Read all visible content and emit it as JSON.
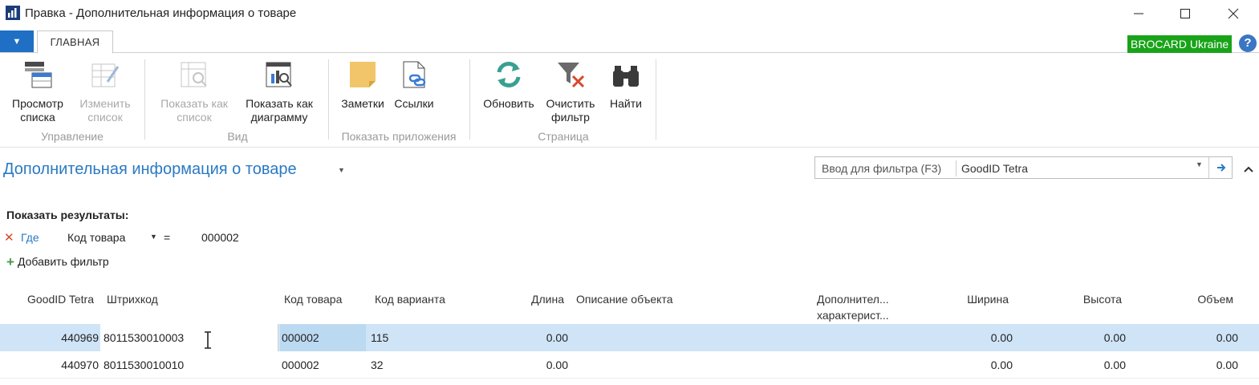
{
  "window": {
    "title": "Правка - Дополнительная информация о товаре"
  },
  "ribbon": {
    "home_tab": "ГЛАВНАЯ",
    "company": "BROCARD Ukraine",
    "help": "?",
    "groups": {
      "manage": "Управление",
      "view": "Вид",
      "show_attached": "Показать приложения",
      "page": "Страница"
    },
    "buttons": {
      "view_list_1": "Просмотр",
      "view_list_2": "списка",
      "edit_list_1": "Изменить",
      "edit_list_2": "список",
      "show_as_list_1": "Показать как",
      "show_as_list_2": "список",
      "show_as_chart_1": "Показать как",
      "show_as_chart_2": "диаграмму",
      "notes": "Заметки",
      "links": "Ссылки",
      "refresh": "Обновить",
      "clear_filter_1": "Очистить",
      "clear_filter_2": "фильтр",
      "find": "Найти"
    }
  },
  "page": {
    "title": "Дополнительная информация о товаре",
    "filter_label": "Ввод для фильтра (F3)",
    "filter_field": "GoodID Tetra"
  },
  "filters": {
    "show_results": "Показать результаты:",
    "where": "Где",
    "field": "Код товара",
    "operator": "=",
    "value": "000002",
    "add_filter": "Добавить фильтр"
  },
  "table": {
    "headers": {
      "goodid": "GoodID Tetra",
      "barcode": "Штрихкод",
      "item_code": "Код товара",
      "variant_code": "Код варианта",
      "length": "Длина",
      "object_desc": "Описание объекта",
      "extra_1": "Дополнител...",
      "extra_2": "характерист...",
      "width": "Ширина",
      "height": "Высота",
      "volume": "Объем"
    },
    "rows": [
      {
        "goodid": "440969",
        "barcode": "8011530010003",
        "item_code": "000002",
        "variant_code": "115",
        "length": "0.00",
        "object_desc": "",
        "extra": "",
        "width": "0.00",
        "height": "0.00",
        "volume": "0.00"
      },
      {
        "goodid": "440970",
        "barcode": "8011530010010",
        "item_code": "000002",
        "variant_code": "32",
        "length": "0.00",
        "object_desc": "",
        "extra": "",
        "width": "0.00",
        "height": "0.00",
        "volume": "0.00"
      }
    ]
  },
  "colors": {
    "accent": "#2a79c4",
    "company_badge": "#19a319",
    "selected_row": "#cfe4f7"
  }
}
